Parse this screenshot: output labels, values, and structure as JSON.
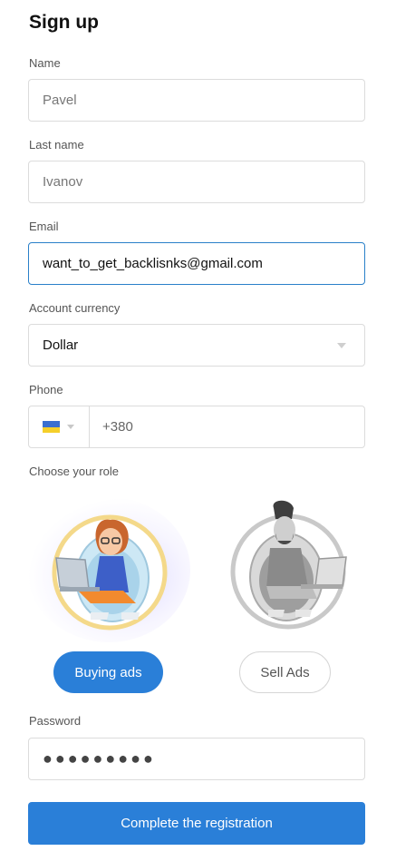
{
  "form": {
    "title": "Sign up",
    "name": {
      "label": "Name",
      "value": "Pavel"
    },
    "last_name": {
      "label": "Last name",
      "value": "Ivanov"
    },
    "email": {
      "label": "Email",
      "value": "want_to_get_backlisnks@gmail.com"
    },
    "currency": {
      "label": "Account currency",
      "value": "Dollar"
    },
    "phone": {
      "label": "Phone",
      "country_flag": "ukraine-flag-icon",
      "value": "+380"
    },
    "role": {
      "label": "Choose your role",
      "options": [
        {
          "label": "Buying ads",
          "selected": true
        },
        {
          "label": "Sell Ads",
          "selected": false
        }
      ]
    },
    "password": {
      "label": "Password",
      "value": "●●●●●●●●●"
    },
    "submit_label": "Complete the registration"
  },
  "colors": {
    "accent": "#2a7fd8",
    "focus_border": "#2a80c9",
    "border": "#dcdcdc",
    "flag_blue": "#3a6fd0",
    "flag_yellow": "#f5cf2a"
  }
}
